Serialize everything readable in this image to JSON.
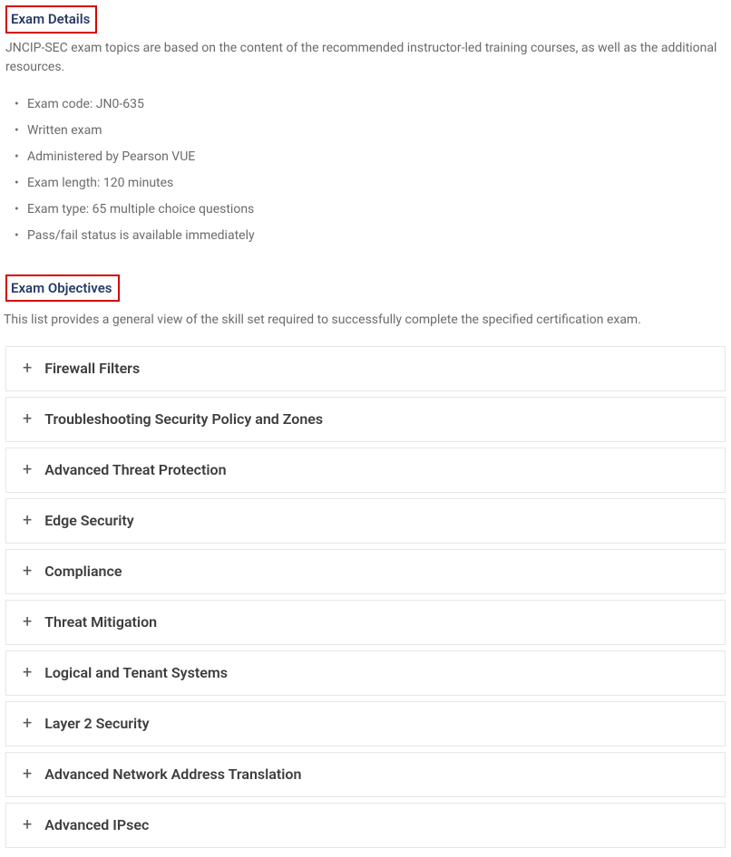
{
  "examDetails": {
    "heading": "Exam Details",
    "intro": "JNCIP-SEC exam topics are based on the content of the recommended instructor-led training courses, as well as the additional resources.",
    "items": [
      "Exam code: JN0-635",
      "Written exam",
      "Administered by Pearson VUE",
      "Exam length: 120 minutes",
      "Exam type: 65 multiple choice questions",
      "Pass/fail status is available immediately"
    ]
  },
  "examObjectives": {
    "heading": "Exam Objectives",
    "intro": "This list provides a general view of the skill set required to successfully complete the specified certification exam.",
    "topics": [
      "Firewall Filters",
      "Troubleshooting Security Policy and Zones",
      "Advanced Threat Protection",
      "Edge Security",
      "Compliance",
      "Threat Mitigation",
      "Logical and Tenant Systems",
      "Layer 2 Security",
      "Advanced Network Address Translation",
      "Advanced IPsec"
    ]
  }
}
